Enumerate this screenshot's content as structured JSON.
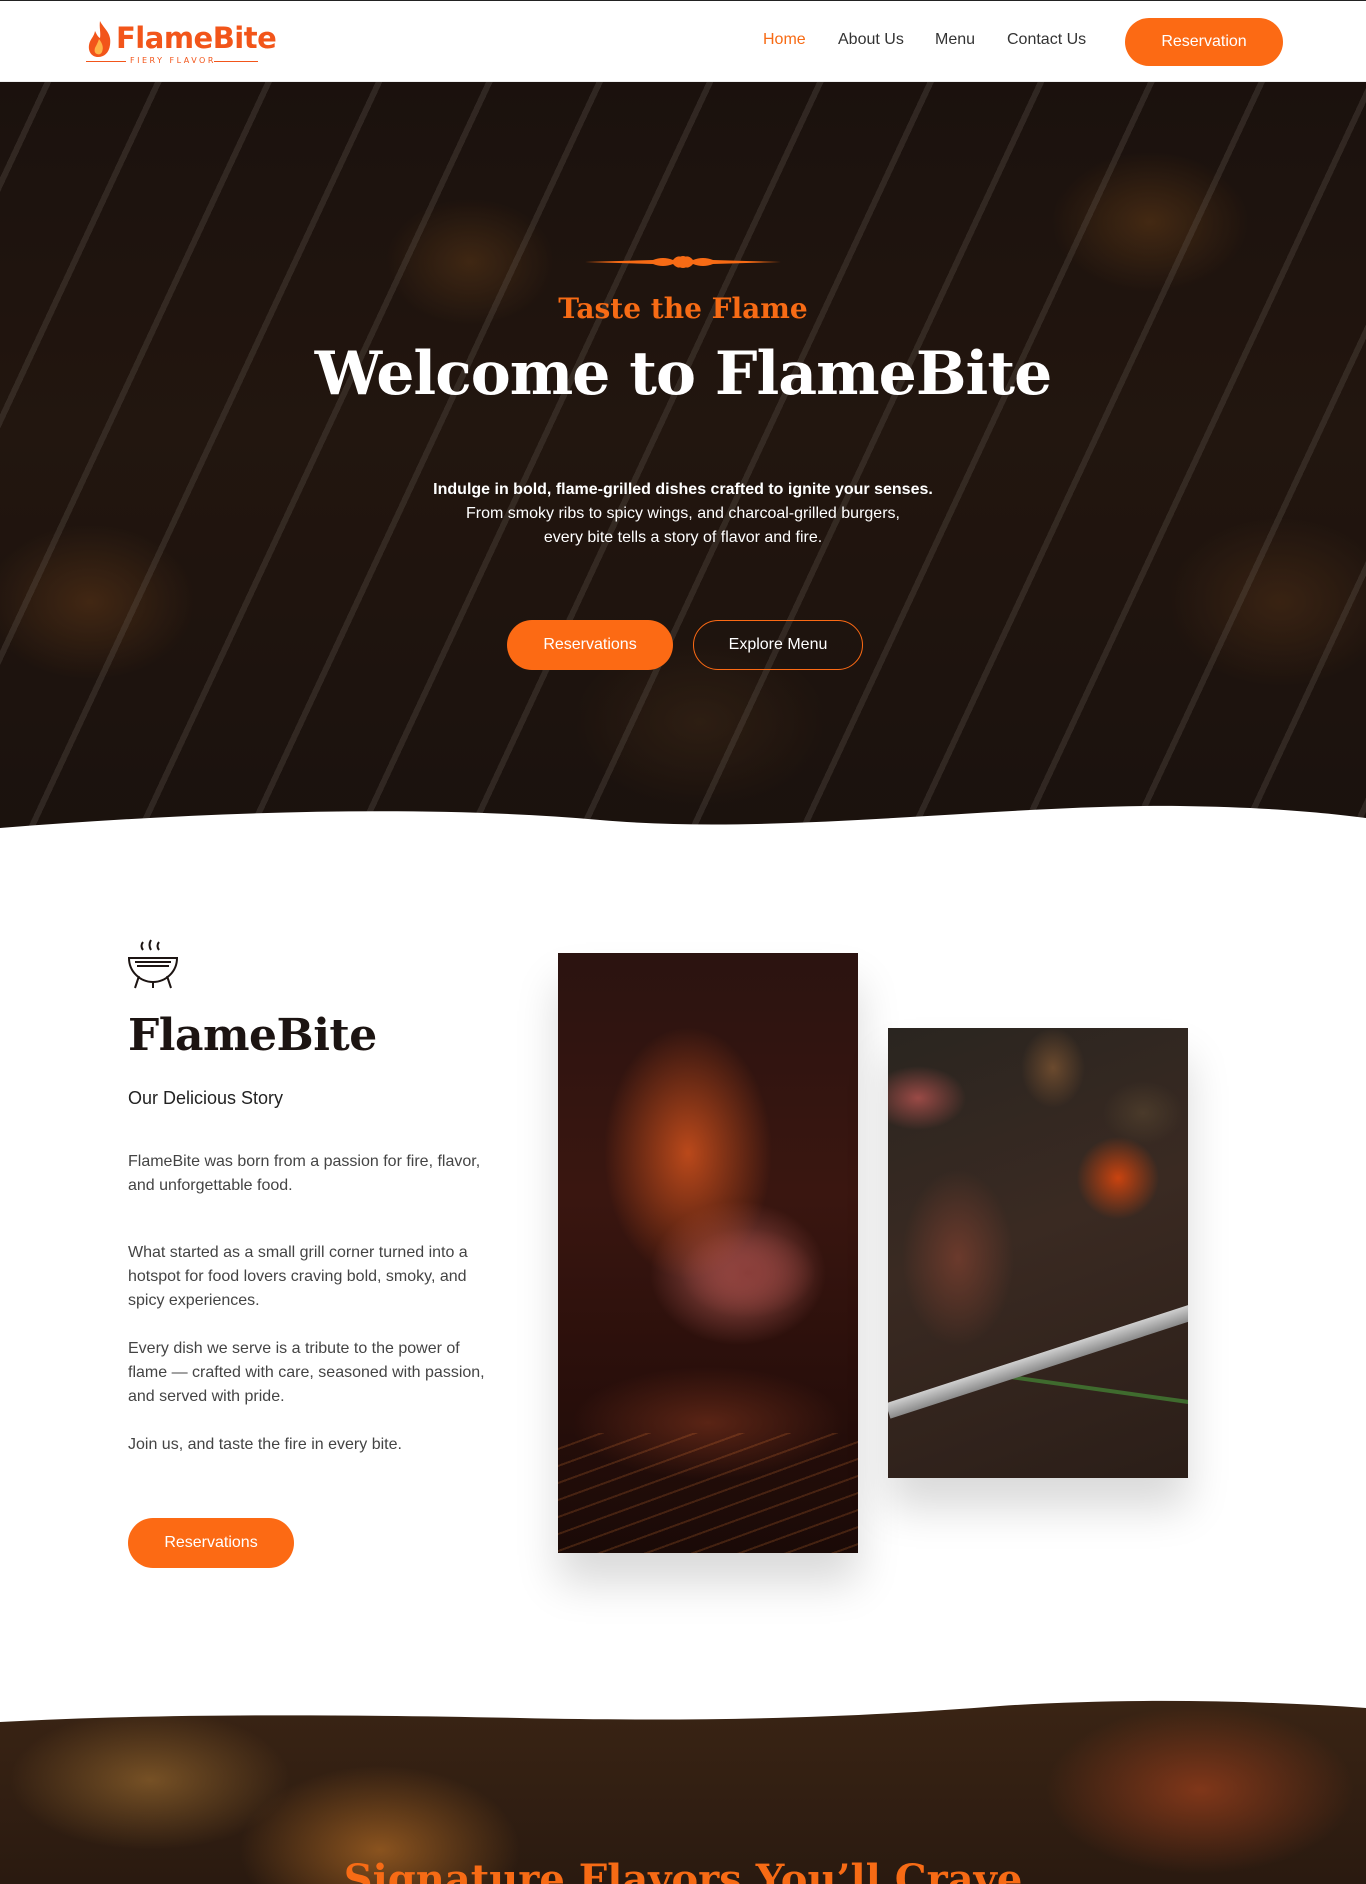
{
  "brand": {
    "name": "FlameBite",
    "tagline": "FIERY FLAVOR",
    "accent_color": "#fc6a14"
  },
  "nav": {
    "items": [
      {
        "label": "Home",
        "active": true
      },
      {
        "label": "About Us",
        "active": false
      },
      {
        "label": "Menu",
        "active": false
      },
      {
        "label": "Contact Us",
        "active": false
      }
    ],
    "cta_label": "Reservation"
  },
  "hero": {
    "subtitle": "Taste the Flame",
    "title": "Welcome to FlameBite",
    "lines": [
      "Indulge in bold, flame-grilled dishes crafted to ignite your senses.",
      "From smoky ribs to spicy wings, and charcoal-grilled burgers,",
      "every bite tells a story of flavor and fire."
    ],
    "primary_button": "Reservations",
    "secondary_button": "Explore Menu"
  },
  "story": {
    "icon": "grill-icon",
    "title": "FlameBite",
    "subtitle": "Our Delicious Story",
    "paragraphs": [
      "FlameBite was born from a passion for fire, flavor, and unforgettable food.",
      "What started as a small grill corner turned into a hotspot for food lovers craving bold, smoky, and spicy experiences.",
      "Every dish we serve is a tribute to the power of flame — crafted with care, seasoned with passion, and served with pride.",
      "Join us, and taste the fire in every bite."
    ],
    "button": "Reservations"
  },
  "signature": {
    "title": "Signature Flavors You’ll Crave"
  }
}
